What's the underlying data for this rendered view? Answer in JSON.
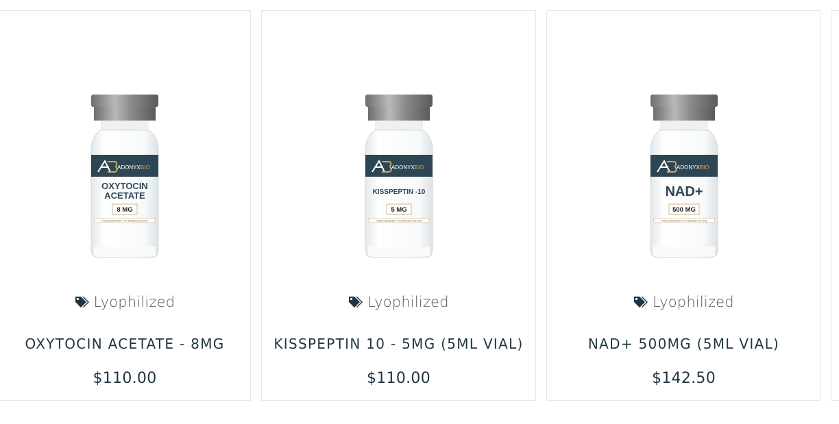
{
  "products": [
    {
      "category": "Lyophilized",
      "name": "OXYTOCIN ACETATE - 8MG",
      "price": "$110.00",
      "label": {
        "brand": "ADONYX",
        "brand_suffix": "BIO",
        "line1": "OXYTOCIN",
        "line2": "ACETATE",
        "dose": "8 MG",
        "note": "Purity Exceeds 99% • For Research Use Only"
      }
    },
    {
      "category": "Lyophilized",
      "name": "KISSPEPTIN 10 - 5MG (5ML VIAL)",
      "price": "$110.00",
      "label": {
        "brand": "ADONYX",
        "brand_suffix": "BIO",
        "line1": "KISSPEPTIN -10",
        "line2": "",
        "dose": "5 MG",
        "note": "Purity Exceeds 99% • For Research Use Only"
      }
    },
    {
      "category": "Lyophilized",
      "name": "NAD+ 500MG (5ML VIAL)",
      "price": "$142.50",
      "label": {
        "brand": "ADONYX",
        "brand_suffix": "BIO",
        "line1": "NAD+",
        "line2": "",
        "dose": "500 MG",
        "note": "Purity Exceeds 99% • For Research Use Only"
      }
    }
  ],
  "colors": {
    "title": "#1f3541",
    "category": "#555555",
    "label_band": "#2e4654",
    "accent_gold": "#c8a766",
    "card_border": "#e6e6e6"
  }
}
